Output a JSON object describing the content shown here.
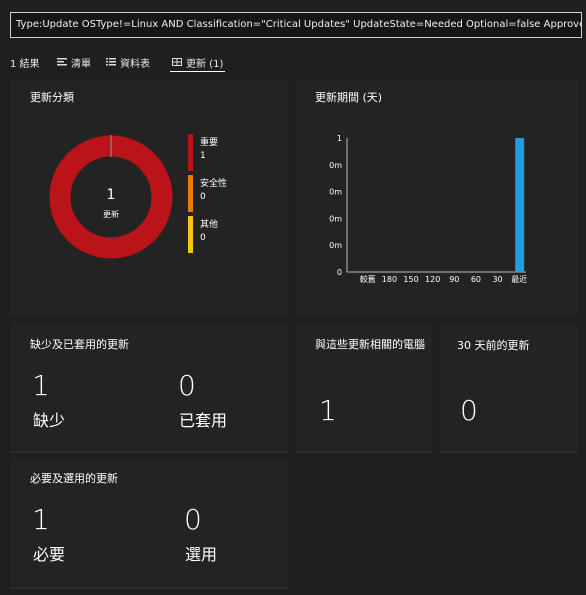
{
  "query": "Type:Update OSType!=Linux AND Classification=\"Critical Updates\" UpdateState=Needed Optional=false Approved!=false",
  "tabs": [
    {
      "label": "1 結果",
      "icon": "results-count"
    },
    {
      "label": "清單",
      "icon": "list-icon"
    },
    {
      "label": "資料表",
      "icon": "table-icon"
    },
    {
      "label": "更新 (1)",
      "icon": "updates-icon",
      "active": true
    }
  ],
  "classification_tile": {
    "title": "更新分類",
    "center_value": "1",
    "center_label": "更新",
    "legend": [
      {
        "label": "重要",
        "value": "1",
        "color": "#ba141a"
      },
      {
        "label": "安全性",
        "value": "0",
        "color": "#ec7a08"
      },
      {
        "label": "其他",
        "value": "0",
        "color": "#f2c811"
      }
    ]
  },
  "period_tile": {
    "title": "更新期間 (天)"
  },
  "chart_data": {
    "type": "bar",
    "categories": [
      "較舊",
      "180",
      "150",
      "120",
      "90",
      "60",
      "30",
      "最近"
    ],
    "values": [
      0,
      0,
      0,
      0,
      0,
      0,
      0,
      1
    ],
    "y_ticks": [
      "1",
      "0m",
      "0m",
      "0m",
      "0m",
      "0"
    ],
    "ylim": [
      0,
      1
    ],
    "bar_color": "#1ba1e2"
  },
  "missing_applied": {
    "title": "缺少及已套用的更新",
    "missing_value": "1",
    "missing_label": "缺少",
    "applied_value": "0",
    "applied_label": "已套用"
  },
  "computers": {
    "title": "與這些更新相關的電腦",
    "value": "1"
  },
  "older30": {
    "title": "30 天前的更新",
    "value": "0"
  },
  "required_optional": {
    "title": "必要及選用的更新",
    "required_value": "1",
    "required_label": "必要",
    "optional_value": "0",
    "optional_label": "選用"
  }
}
